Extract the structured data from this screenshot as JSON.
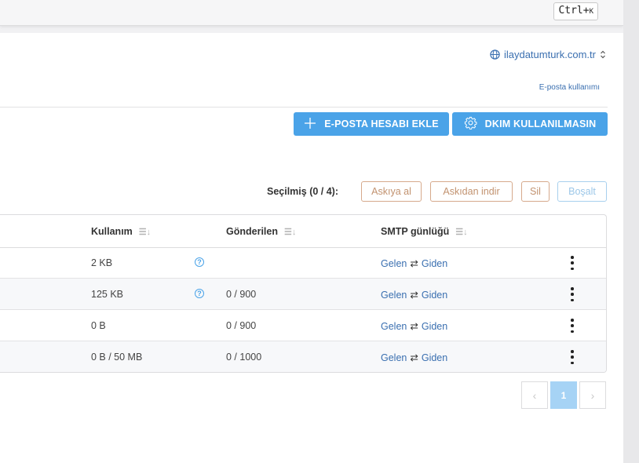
{
  "header": {
    "shortcut_main": "Ctrl+",
    "shortcut_key": "K"
  },
  "domain": {
    "name": "ilaydatumturk.com.tr"
  },
  "usage_link": "E-posta kullanımı",
  "actions": {
    "add_account": "E-POSTA HESABI EKLE",
    "dkim": "DKIM KULLANILMASIN"
  },
  "selection": {
    "label": "Seçilmiş (0 / 4):",
    "suspend": "Askıya al",
    "unsuspend": "Askıdan indir",
    "delete": "Sil",
    "empty": "Boşalt"
  },
  "table": {
    "headers": {
      "usage": "Kullanım",
      "sent": "Gönderilen",
      "smtp_log": "SMTP günlüğü"
    },
    "rows": [
      {
        "usage": "2 KB",
        "sent": "",
        "incoming": "Gelen",
        "arrows": "⇄",
        "outgoing": "Giden"
      },
      {
        "usage": "125 KB",
        "sent": "0 / 900",
        "incoming": "Gelen",
        "arrows": "⇄",
        "outgoing": "Giden"
      },
      {
        "usage": "0 B",
        "sent": "0 / 900",
        "incoming": "Gelen",
        "arrows": "⇄",
        "outgoing": "Giden"
      },
      {
        "usage": "0 B / 50 MB",
        "sent": "0 / 1000",
        "incoming": "Gelen",
        "arrows": "⇄",
        "outgoing": "Giden"
      }
    ]
  },
  "pagination": {
    "prev": "‹",
    "current": "1",
    "next": "›"
  },
  "colors": {
    "primary": "#4aa3e8",
    "link": "#3a6fb0",
    "warning_outline": "#d6a98c"
  }
}
